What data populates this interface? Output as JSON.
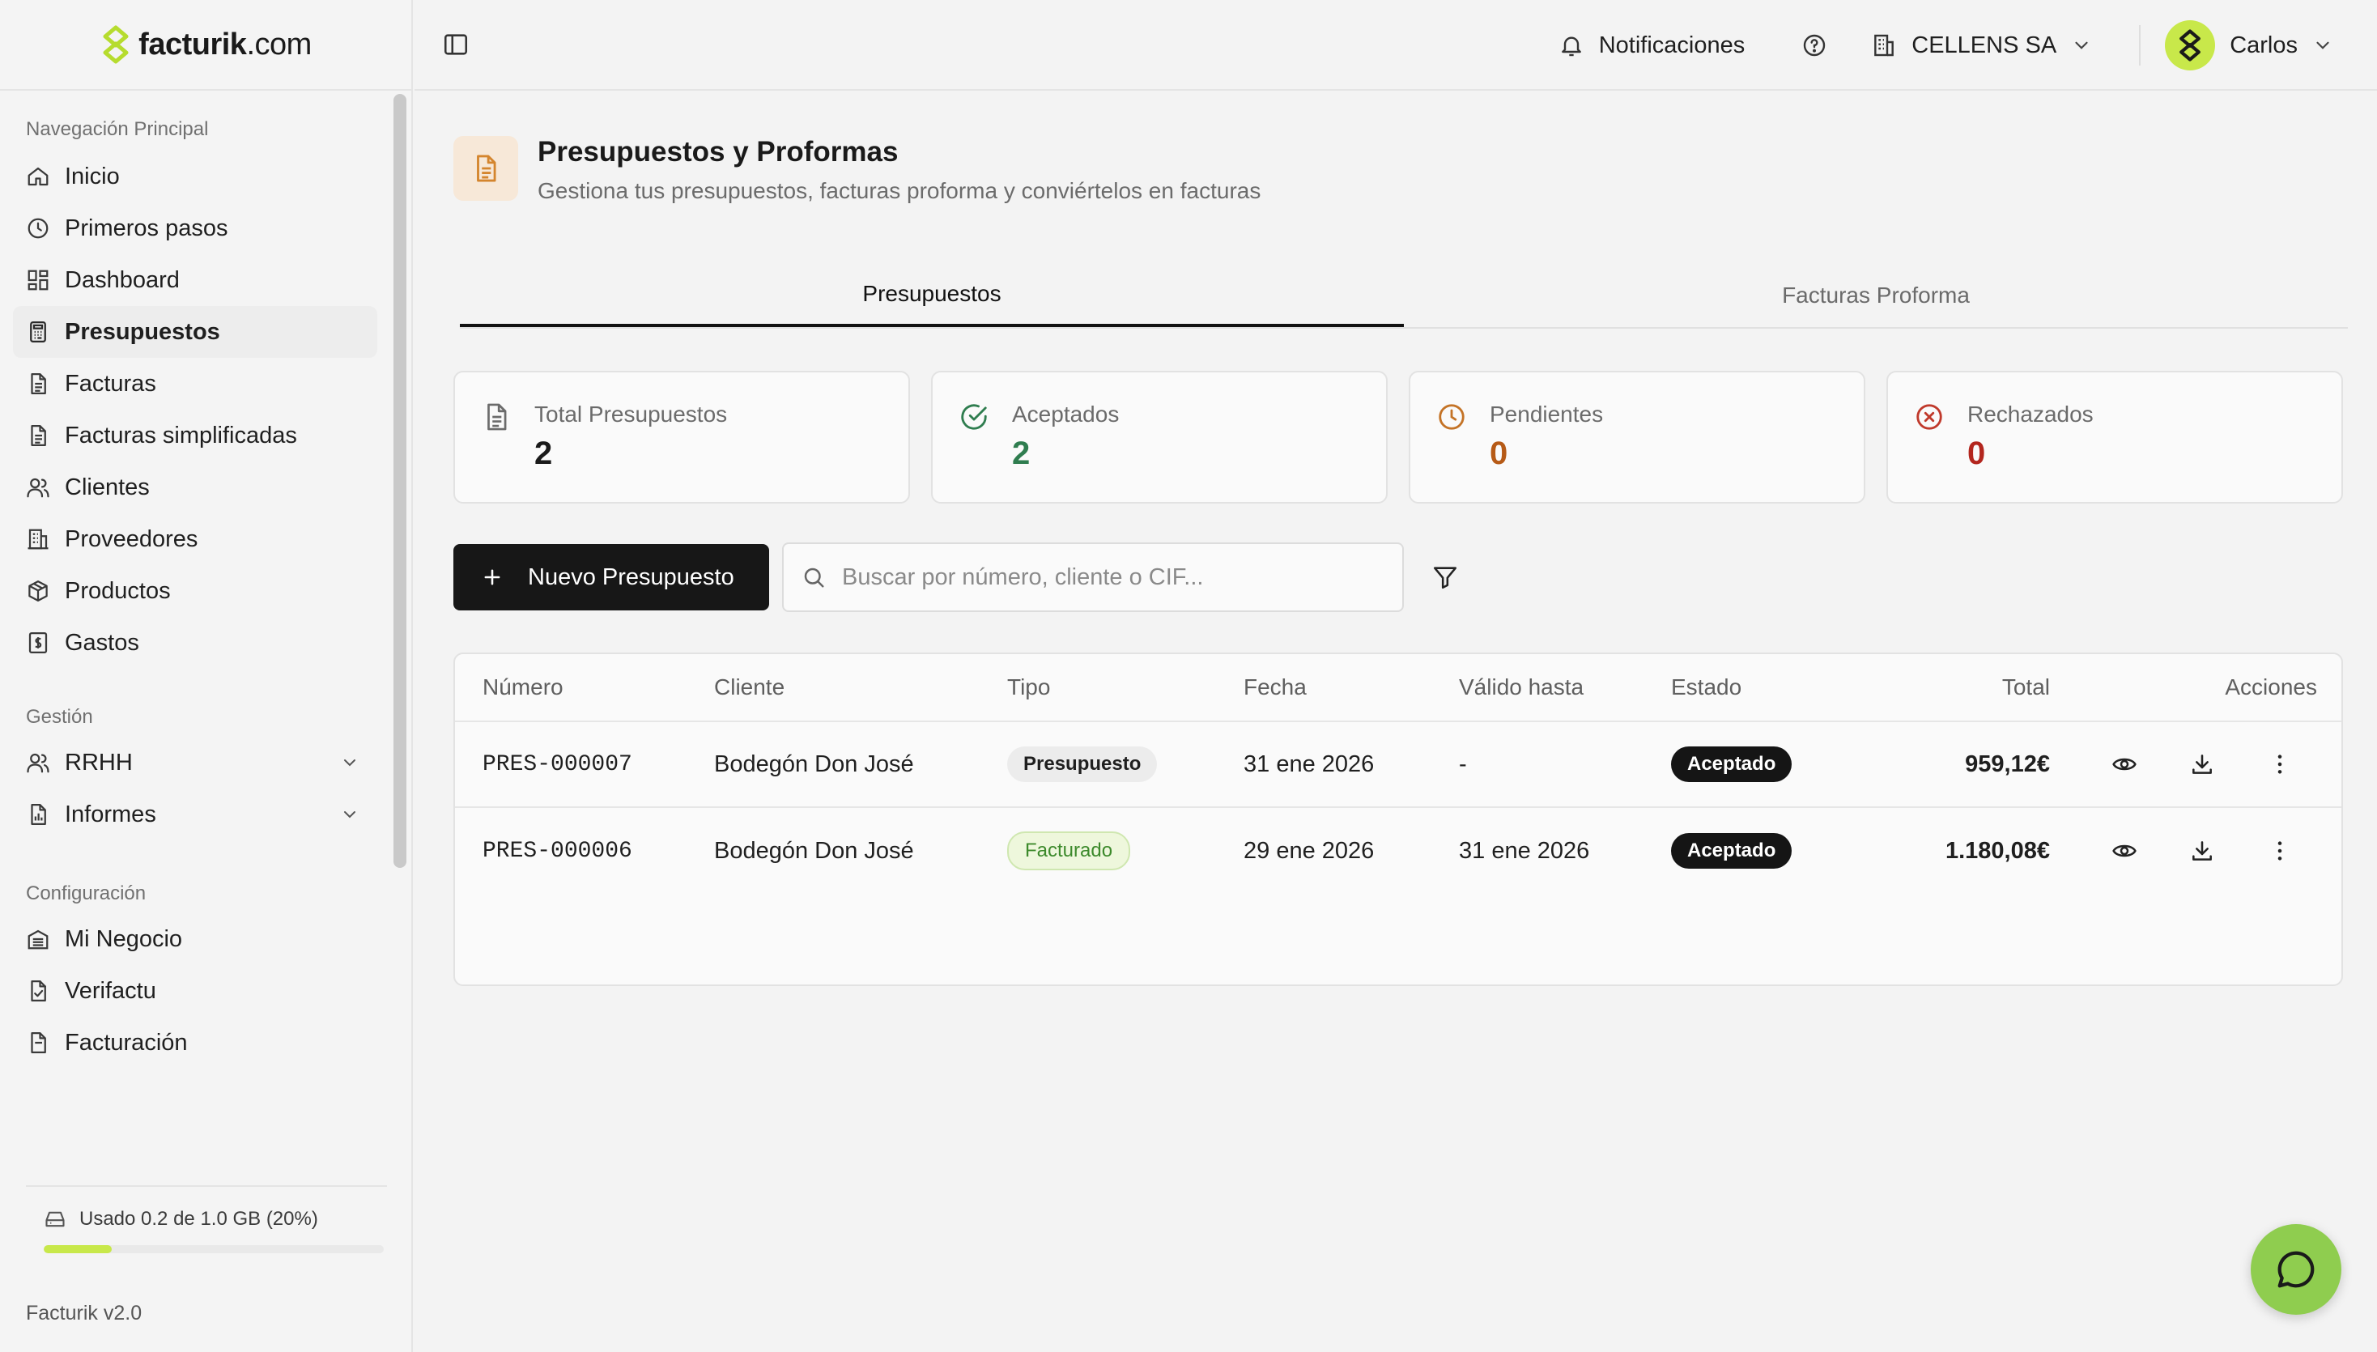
{
  "brand": {
    "name": "facturik",
    "domain": ".com",
    "accent": "#c8e84a"
  },
  "sidebar": {
    "sections": [
      {
        "label": "Navegación Principal"
      },
      {
        "label": "Gestión"
      },
      {
        "label": "Configuración"
      }
    ],
    "main_items": [
      {
        "label": "Inicio",
        "icon": "home-icon"
      },
      {
        "label": "Primeros pasos",
        "icon": "clock-icon"
      },
      {
        "label": "Dashboard",
        "icon": "dashboard-icon"
      },
      {
        "label": "Presupuestos",
        "icon": "calculator-icon",
        "active": true
      },
      {
        "label": "Facturas",
        "icon": "document-icon"
      },
      {
        "label": "Facturas simplificadas",
        "icon": "document-icon"
      },
      {
        "label": "Clientes",
        "icon": "users-icon"
      },
      {
        "label": "Proveedores",
        "icon": "building-icon"
      },
      {
        "label": "Productos",
        "icon": "box-icon"
      },
      {
        "label": "Gastos",
        "icon": "receipt-icon"
      }
    ],
    "management_items": [
      {
        "label": "RRHH",
        "icon": "users-icon"
      },
      {
        "label": "Informes",
        "icon": "report-icon"
      }
    ],
    "config_items": [
      {
        "label": "Mi Negocio",
        "icon": "business-icon"
      },
      {
        "label": "Verifactu",
        "icon": "verified-doc-icon"
      },
      {
        "label": "Facturación",
        "icon": "document-icon"
      }
    ],
    "storage": {
      "text": "Usado 0.2 de 1.0 GB (20%)",
      "fraction": 0.2
    },
    "version": "Facturik v2.0"
  },
  "header": {
    "notifications_label": "Notificaciones",
    "company": "CELLENS SA",
    "user": "Carlos"
  },
  "page": {
    "title": "Presupuestos y Proformas",
    "subtitle": "Gestiona tus presupuestos, facturas proforma y conviértelos en facturas",
    "tabs": [
      {
        "label": "Presupuestos",
        "active": true
      },
      {
        "label": "Facturas Proforma"
      }
    ],
    "stats": [
      {
        "label": "Total Presupuestos",
        "value": "2",
        "color": "#1a1a1a"
      },
      {
        "label": "Aceptados",
        "value": "2",
        "color": "#2f7d4f"
      },
      {
        "label": "Pendientes",
        "value": "0",
        "color": "#b65a16"
      },
      {
        "label": "Rechazados",
        "value": "0",
        "color": "#b3261e"
      }
    ],
    "new_button": "Nuevo Presupuesto",
    "search_placeholder": "Buscar por número, cliente o CIF..."
  },
  "table": {
    "columns": [
      "Número",
      "Cliente",
      "Tipo",
      "Fecha",
      "Válido hasta",
      "Estado",
      "Total",
      "Acciones"
    ],
    "rows": [
      {
        "numero": "PRES-000007",
        "cliente": "Bodegón Don José",
        "tipo": "Presupuesto",
        "fecha": "31 ene 2026",
        "valido": "-",
        "estado": "Aceptado",
        "total": "959,12€"
      },
      {
        "numero": "PRES-000006",
        "cliente": "Bodegón Don José",
        "tipo": "Facturado",
        "fecha": "29 ene 2026",
        "valido": "31 ene 2026",
        "estado": "Aceptado",
        "total": "1.180,08€"
      }
    ]
  }
}
